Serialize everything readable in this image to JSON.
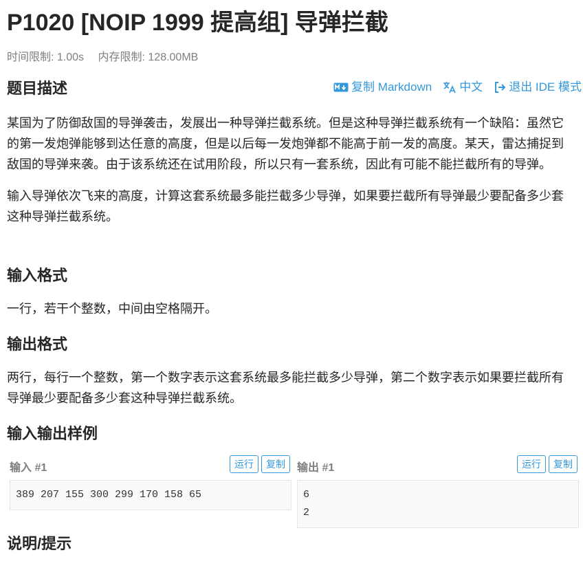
{
  "problem": {
    "title": "P1020 [NOIP 1999 提高组] 导弹拦截",
    "time_limit": "时间限制: 1.00s",
    "memory_limit": "内存限制: 128.00MB"
  },
  "actions": [
    {
      "label": "复制 Markdown",
      "icon": "markdown-icon"
    },
    {
      "label": "中文",
      "icon": "translate-icon"
    },
    {
      "label": "退出 IDE 模式",
      "icon": "exit-icon"
    }
  ],
  "sections": {
    "description_title": "题目描述",
    "description_p1": "某国为了防御敌国的导弹袭击，发展出一种导弹拦截系统。但是这种导弹拦截系统有一个缺陷：虽然它的第一发炮弹能够到达任意的高度，但是以后每一发炮弹都不能高于前一发的高度。某天，雷达捕捉到敌国的导弹来袭。由于该系统还在试用阶段，所以只有一套系统，因此有可能不能拦截所有的导弹。",
    "description_p2": "输入导弹依次飞来的高度，计算这套系统最多能拦截多少导弹，如果要拦截所有导弹最少要配备多少套这种导弹拦截系统。",
    "input_title": "输入格式",
    "input_text": "一行，若干个整数，中间由空格隔开。",
    "output_title": "输出格式",
    "output_text": "两行，每行一个整数，第一个数字表示这套系统最多能拦截多少导弹，第二个数字表示如果要拦截所有导弹最少要配备多少套这种导弹拦截系统。",
    "samples_title": "输入输出样例",
    "hint_title": "说明/提示"
  },
  "samples": {
    "input_label": "输入 #1",
    "output_label": "输出 #1",
    "run_label": "运行",
    "copy_label": "复制",
    "input_value": "389 207 155 300 299 170 158 65",
    "output_value": "6\n2"
  },
  "colors": {
    "accent": "#3498db",
    "muted": "#7f7f7f",
    "text": "#262626"
  }
}
